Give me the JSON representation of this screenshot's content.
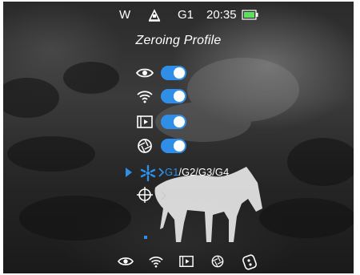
{
  "status": {
    "mode": "W",
    "profile": "G1",
    "time": "20:35",
    "battery_color": "#5de05d"
  },
  "title": "Zeroing Profile",
  "accent_color": "#2f8fe8",
  "menu": [
    {
      "icon": "eye-icon",
      "toggle_on": true
    },
    {
      "icon": "wifi-icon",
      "toggle_on": true
    },
    {
      "icon": "video-record-icon",
      "toggle_on": true
    },
    {
      "icon": "shutter-icon",
      "toggle_on": true
    }
  ],
  "profile_selector": {
    "icon": "zeroing-profile-icon",
    "active": "G1",
    "rest": "/G2/G3/G4"
  },
  "bottom_bar": [
    "eye-icon",
    "wifi-icon",
    "video-record-icon",
    "shutter-icon",
    "remote-icon"
  ]
}
